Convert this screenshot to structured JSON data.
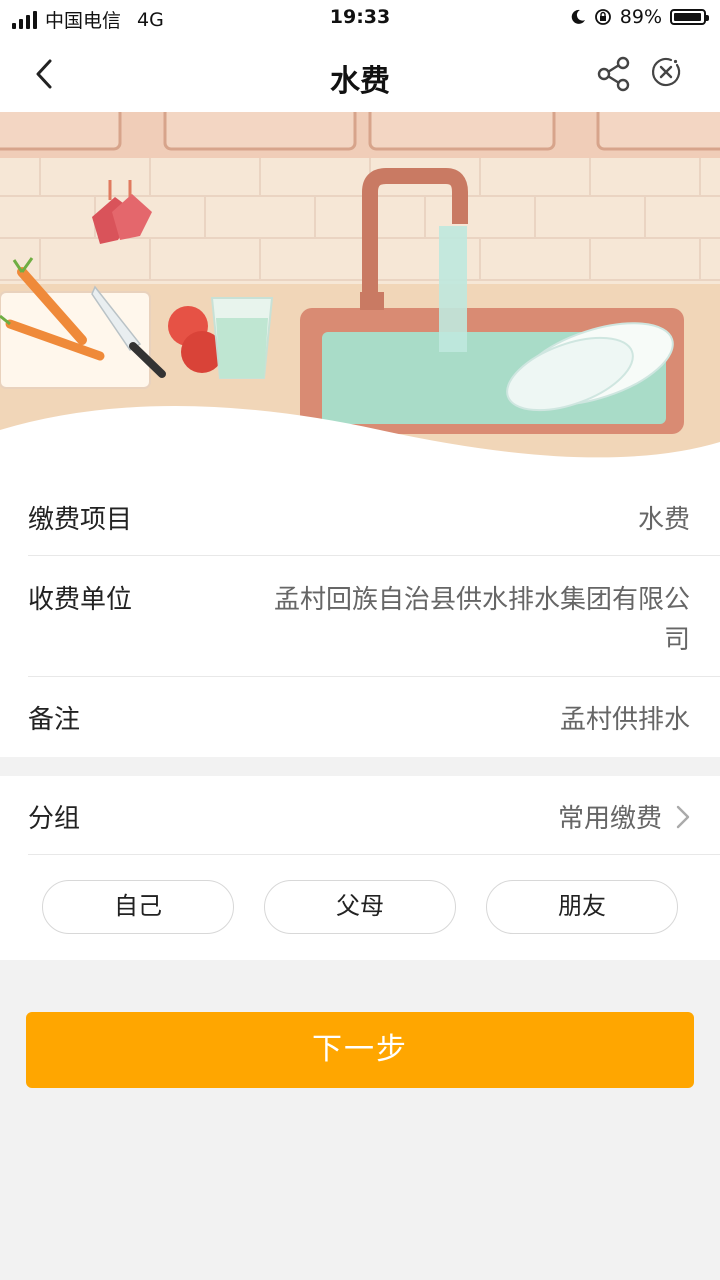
{
  "status_bar": {
    "carrier": "中国电信",
    "network": "4G",
    "time": "19:33",
    "battery": "89%"
  },
  "nav": {
    "title": "水费",
    "icons": [
      "back-icon",
      "share-icon",
      "close-icon"
    ]
  },
  "details": {
    "rows": [
      {
        "label": "缴费项目",
        "value": "水费"
      },
      {
        "label": "收费单位",
        "value_line1": "孟村回族自治县供水排水集团有限公",
        "value_line2": "司"
      },
      {
        "label": "备注",
        "value": "孟村供排水"
      }
    ]
  },
  "group": {
    "label": "分组",
    "value": "常用缴费",
    "options": [
      "自己",
      "父母",
      "朋友"
    ]
  },
  "actions": {
    "next_label": "下一步"
  },
  "colors": {
    "accent": "#ffa600",
    "page_background": "#f2f2f2"
  }
}
